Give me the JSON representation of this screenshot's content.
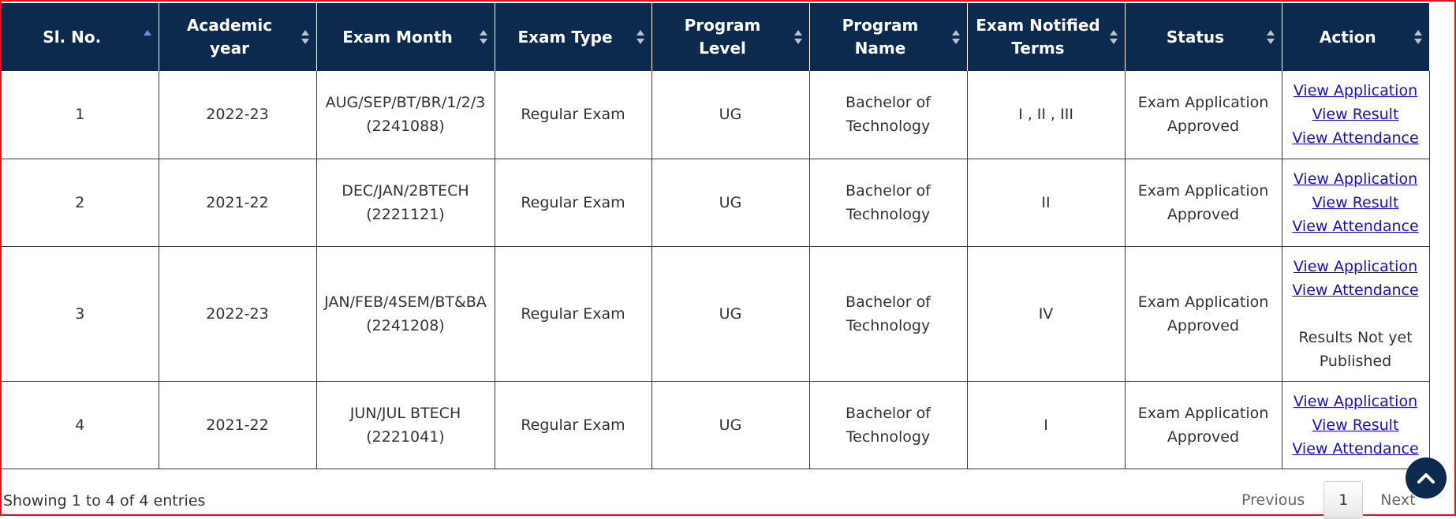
{
  "table": {
    "headers": [
      {
        "label": "Sl. No.",
        "sort": "asc"
      },
      {
        "label": "Academic year",
        "sort": "both"
      },
      {
        "label": "Exam Month",
        "sort": "both"
      },
      {
        "label": "Exam Type",
        "sort": "both"
      },
      {
        "label": "Program Level",
        "sort": "both"
      },
      {
        "label": "Program Name",
        "sort": "both"
      },
      {
        "label": "Exam Notified Terms",
        "sort": "both"
      },
      {
        "label": "Status",
        "sort": "both"
      },
      {
        "label": "Action",
        "sort": "both"
      }
    ],
    "rows": [
      {
        "sl": "1",
        "year": "2022-23",
        "month": "AUG/SEP/BT/BR/1/2/3 (2241088)",
        "type": "Regular Exam",
        "level": "UG",
        "program": "Bachelor of Technology",
        "terms": "I , II , III",
        "status": "Exam Application Approved",
        "actions": [
          "View Application",
          "View Result",
          "View Attendance"
        ],
        "note": ""
      },
      {
        "sl": "2",
        "year": "2021-22",
        "month": "DEC/JAN/2BTECH (2221121)",
        "type": "Regular Exam",
        "level": "UG",
        "program": "Bachelor of Technology",
        "terms": "II",
        "status": "Exam Application Approved",
        "actions": [
          "View Application",
          "View Result",
          "View Attendance"
        ],
        "note": ""
      },
      {
        "sl": "3",
        "year": "2022-23",
        "month": "JAN/FEB/4SEM/BT&BA (2241208)",
        "type": "Regular Exam",
        "level": "UG",
        "program": "Bachelor of Technology",
        "terms": "IV",
        "status": "Exam Application Approved",
        "actions": [
          "View Application",
          "View Attendance"
        ],
        "note": "Results Not yet Published"
      },
      {
        "sl": "4",
        "year": "2021-22",
        "month": "JUN/JUL BTECH (2221041)",
        "type": "Regular Exam",
        "level": "UG",
        "program": "Bachelor of Technology",
        "terms": "I",
        "status": "Exam Application Approved",
        "actions": [
          "View Application",
          "View Result",
          "View Attendance"
        ],
        "note": ""
      }
    ]
  },
  "footer": {
    "info": "Showing 1 to 4 of 4 entries",
    "previous": "Previous",
    "page": "1",
    "next": "Next"
  },
  "scroll_top_icon": "chevron-up-icon",
  "colors": {
    "header_bg": "#0b2a4e",
    "link": "#1a0dcc",
    "frame": "#e0141b"
  }
}
